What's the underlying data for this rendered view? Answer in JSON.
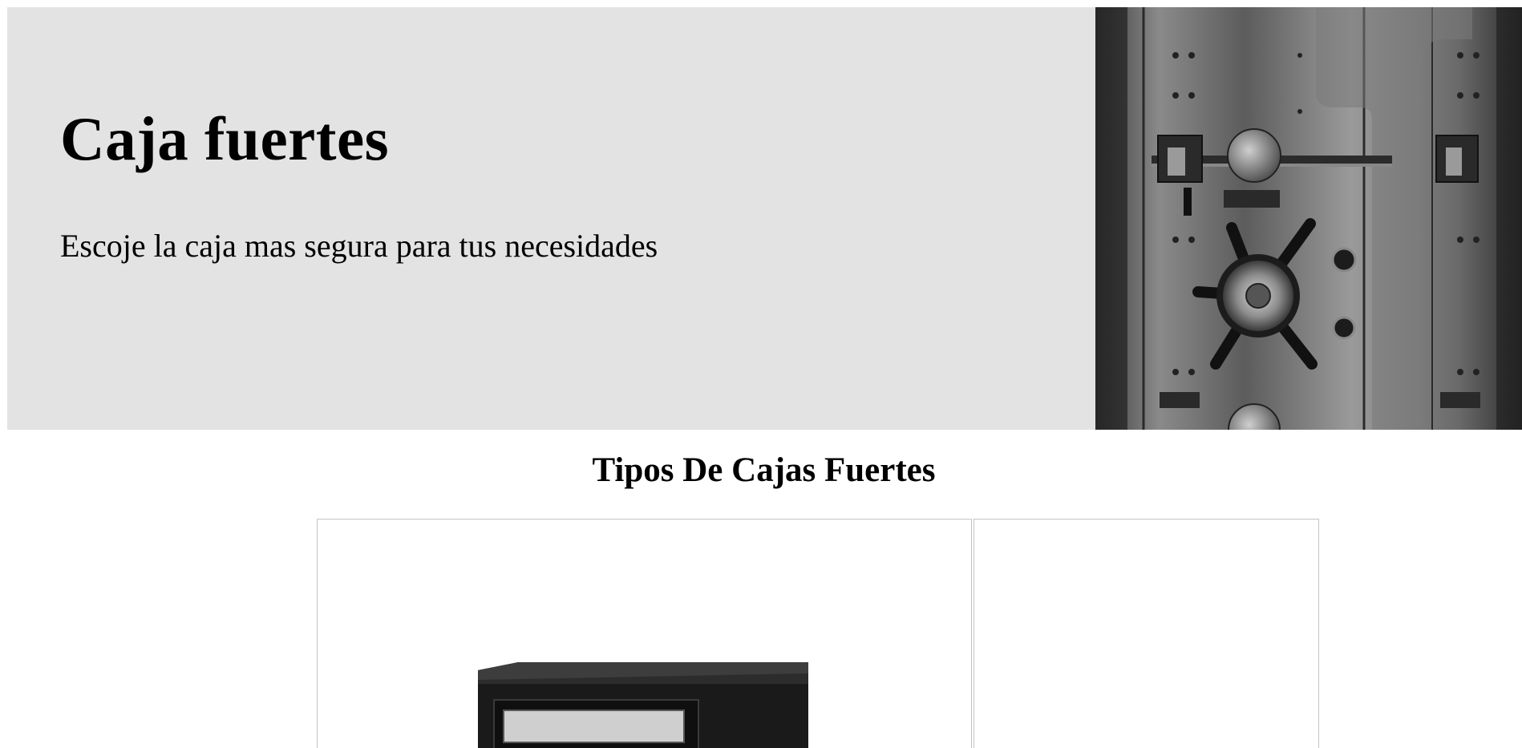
{
  "hero": {
    "title": "Caja fuertes",
    "subtitle": "Escoje la caja mas segura para tus necesidades",
    "image_icon": "bank-vault-door-photo",
    "background_color": "#e3e3e3"
  },
  "section": {
    "title": "Tipos De Cajas Fuertes"
  },
  "cards": [
    {
      "image_icon": "black-safe-box-photo"
    },
    {
      "image_icon": "empty-image"
    }
  ]
}
